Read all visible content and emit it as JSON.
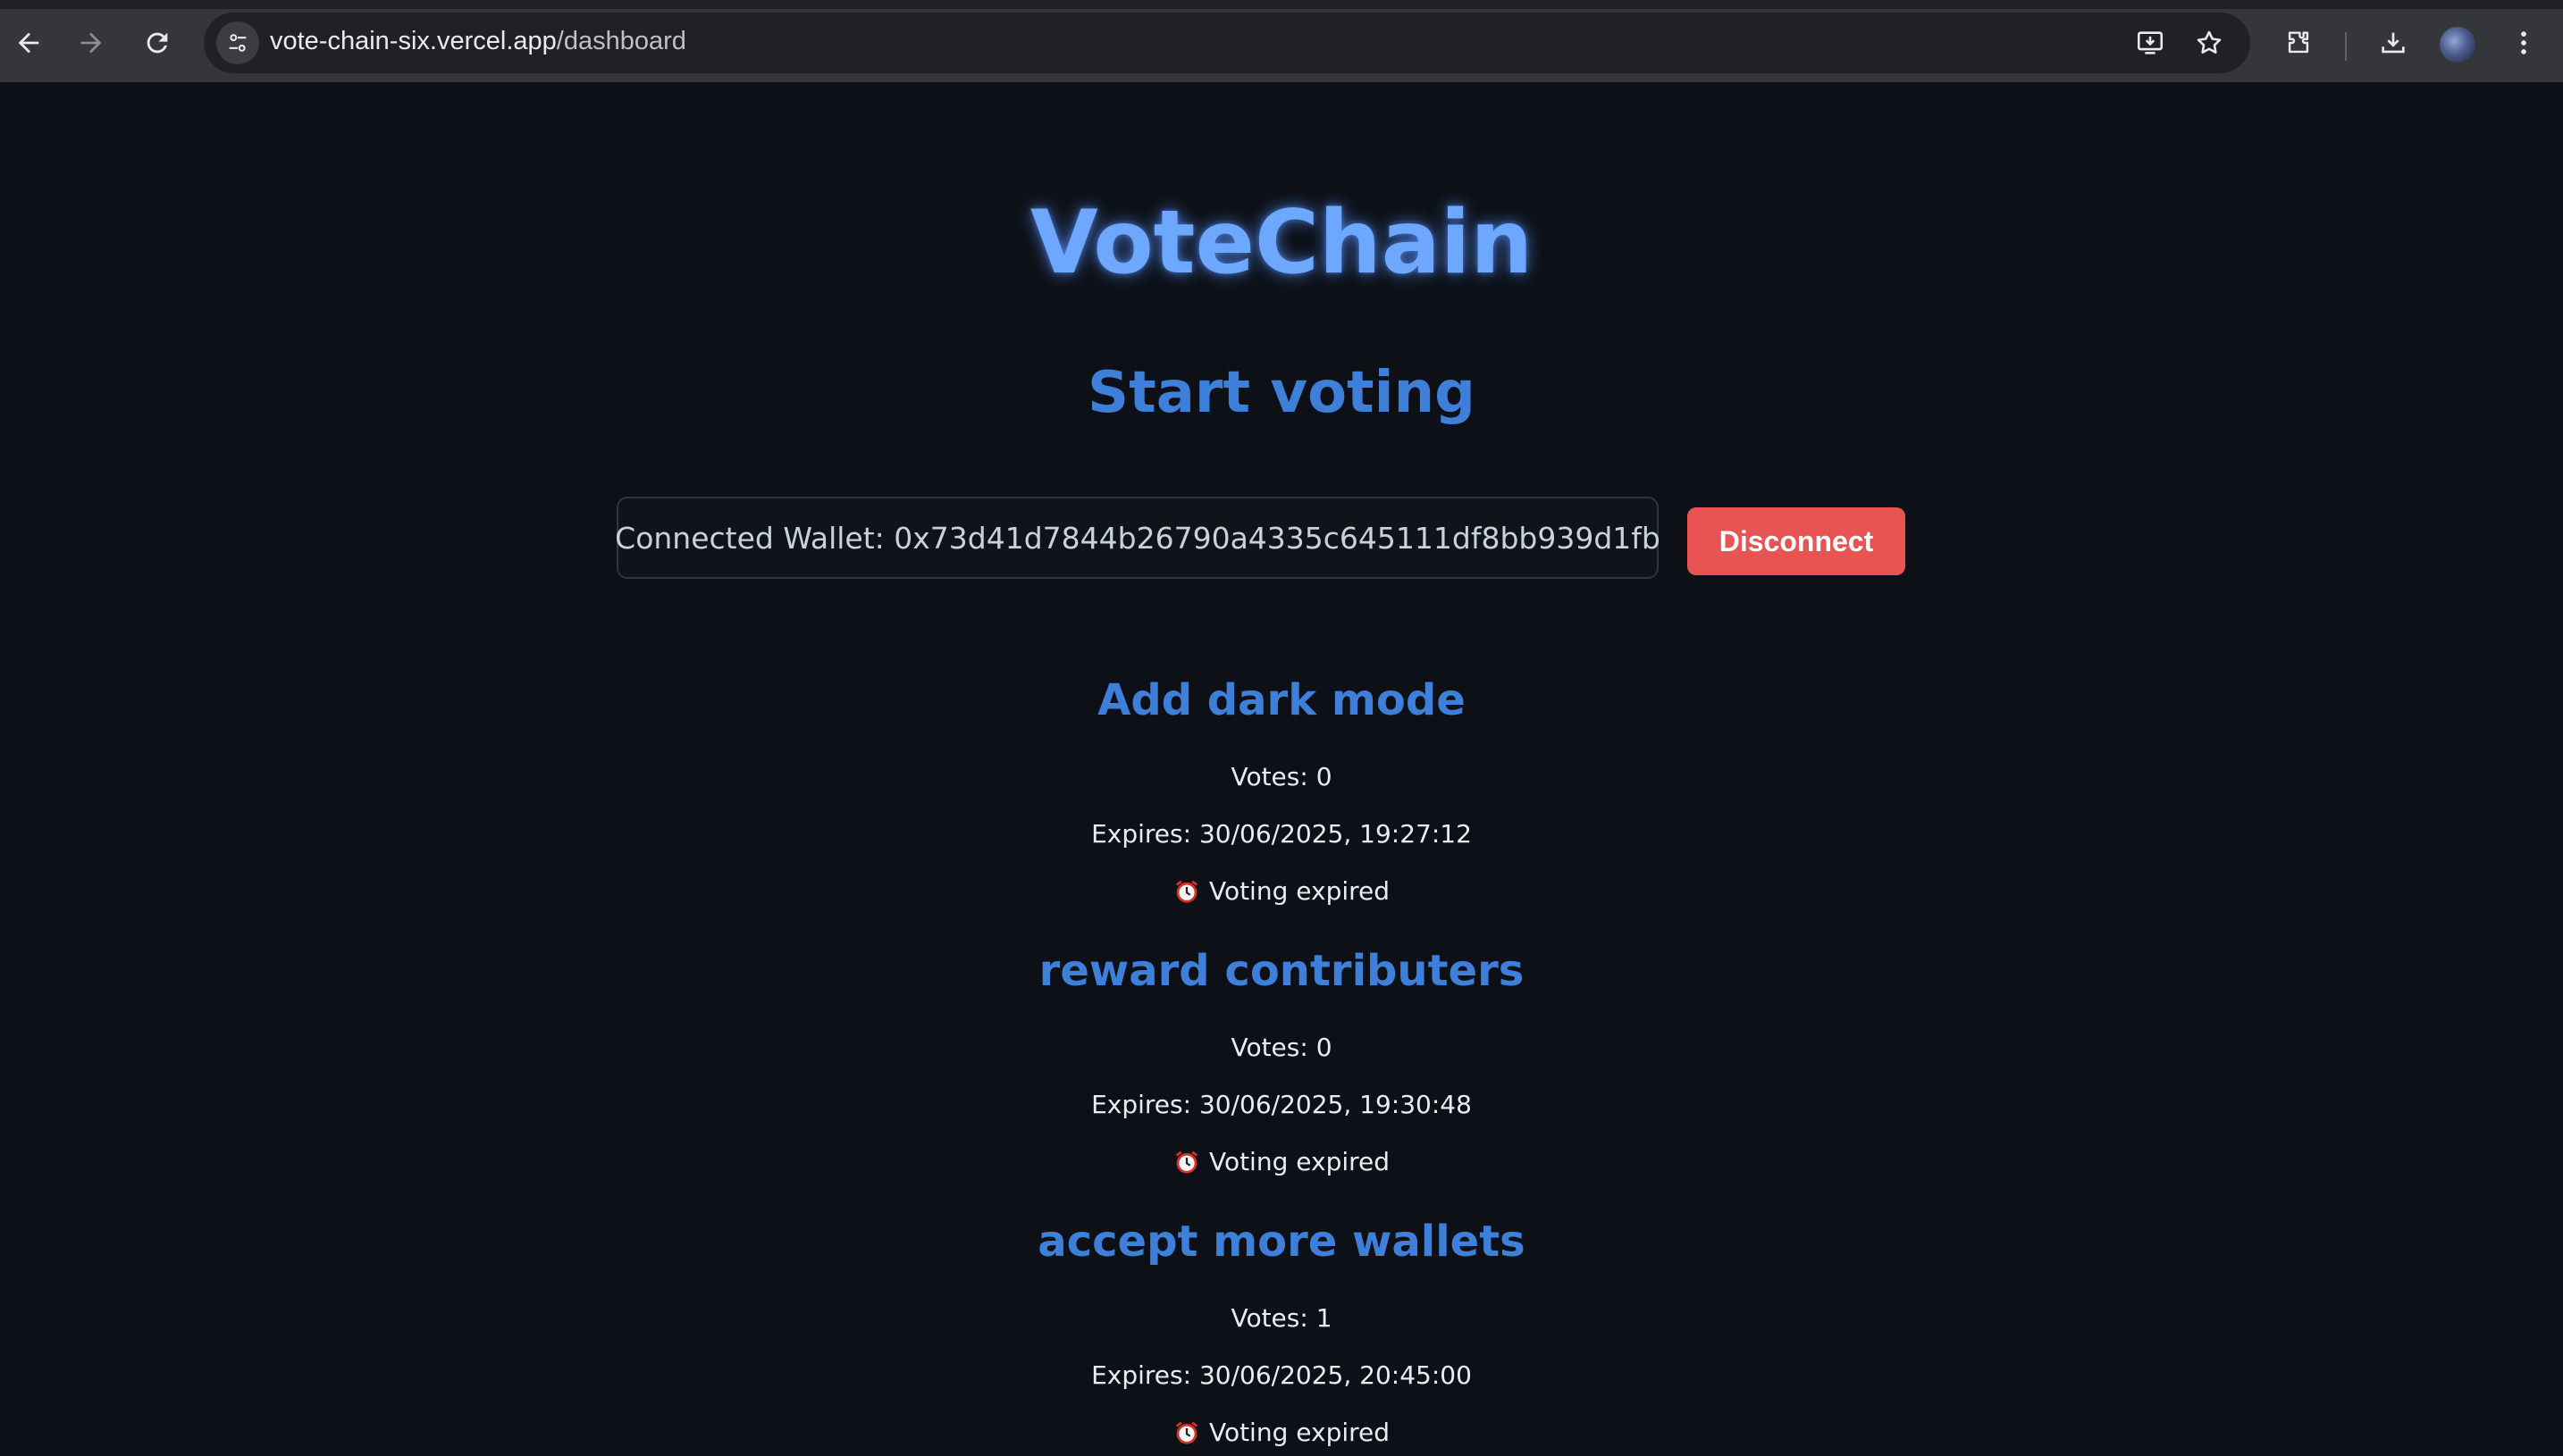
{
  "browser": {
    "url_host": "vote-chain-six.vercel.app",
    "url_path": "/dashboard"
  },
  "page": {
    "app_title": "VoteChain",
    "subtitle": "Start voting"
  },
  "wallet": {
    "label": "Connected Wallet: 0x73d41d7844b26790a4335c645111df8bb939d1fb",
    "disconnect_label": "Disconnect"
  },
  "proposals": [
    {
      "title": "Add dark mode",
      "votes": "Votes: 0",
      "expires": "Expires: 30/06/2025, 19:27:12",
      "status": "Voting expired"
    },
    {
      "title": "reward contributers",
      "votes": "Votes: 0",
      "expires": "Expires: 30/06/2025, 19:30:48",
      "status": "Voting expired"
    },
    {
      "title": "accept more wallets",
      "votes": "Votes: 1",
      "expires": "Expires: 30/06/2025, 20:45:00",
      "status": "Voting expired"
    }
  ],
  "icons": {
    "back": "back-arrow-icon",
    "forward": "forward-arrow-icon",
    "reload": "reload-icon",
    "site_info": "tune-icon",
    "install": "install-app-icon",
    "bookmark": "star-icon",
    "extensions": "puzzle-icon",
    "downloads": "download-icon",
    "menu": "kebab-menu-icon",
    "status": "alarm-clock-icon"
  },
  "colors": {
    "background": "#0d1117",
    "accent_title": "#6ea8fe",
    "accent_heading": "#3d7fd9",
    "danger": "#e85454"
  }
}
